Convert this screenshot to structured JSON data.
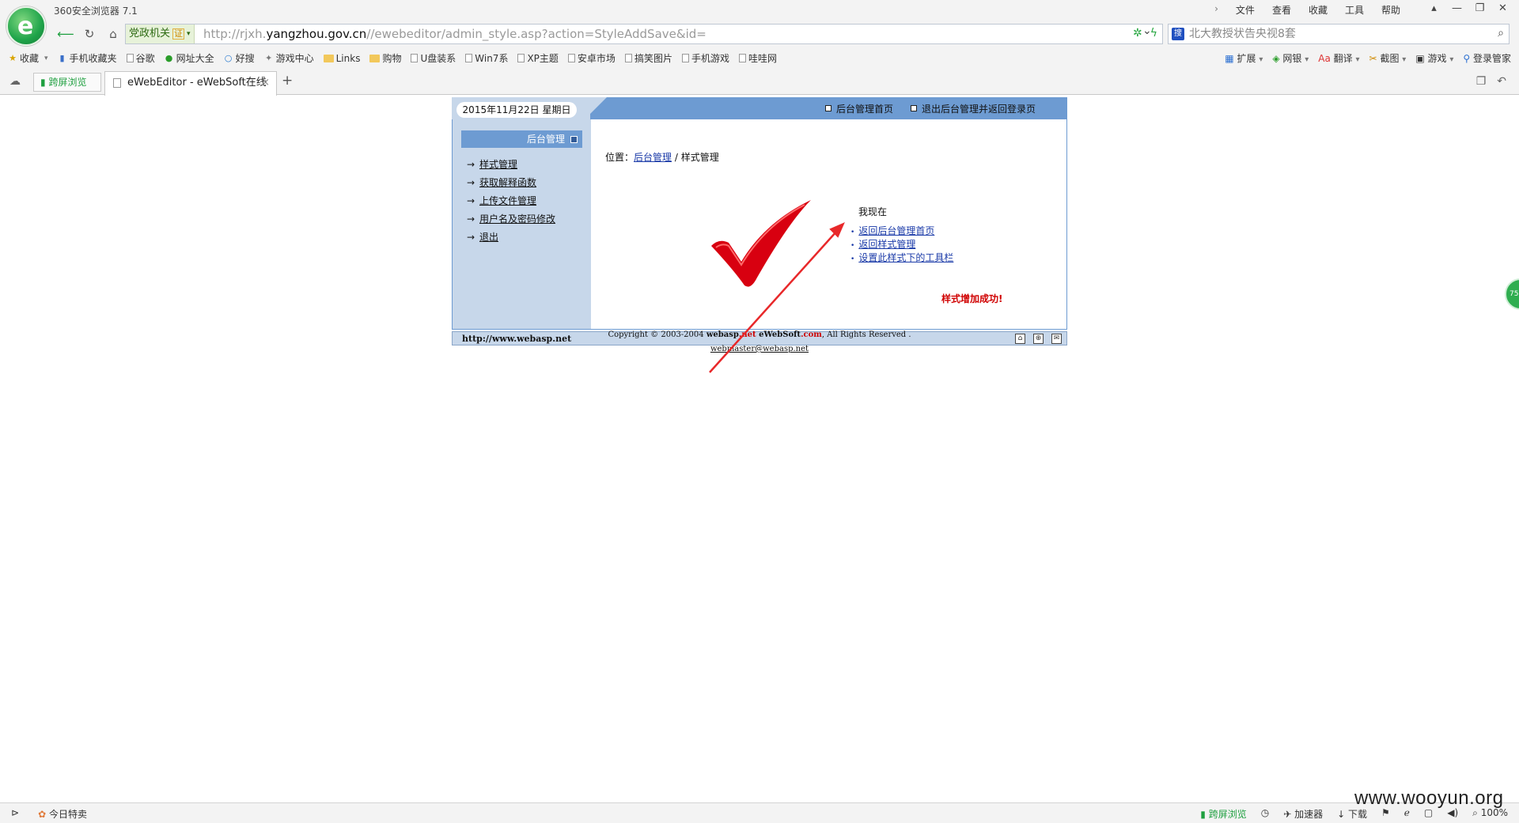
{
  "browser": {
    "app_title": "360安全浏览器 7.1",
    "menu": [
      "文件",
      "查看",
      "收藏",
      "工具",
      "帮助"
    ],
    "window_controls": [
      "衬衫",
      "最小化",
      "还原",
      "关闭"
    ],
    "zone_label": "党政机关",
    "zone_cert": "证",
    "url_prefix": "http://rjxh.",
    "url_host": "yangzhou.gov.cn",
    "url_path": "//ewebeditor/admin_style.asp?action=StyleAddSave&id=",
    "search_placeholder": "北大教授状告央视8套",
    "bookmarks": [
      "收藏",
      "手机收藏夹",
      "谷歌",
      "网址大全",
      "好搜",
      "游戏中心",
      "Links",
      "购物",
      "U盘装系",
      "Win7系",
      "XP主题",
      "安卓市场",
      "搞笑图片",
      "手机游戏",
      "哇哇网"
    ],
    "toolbar_right": [
      "扩展",
      "网银",
      "翻译",
      "截图",
      "游戏",
      "登录管家"
    ],
    "tab_split_label": "跨屏浏览",
    "tab_active_title": "eWebEditor - eWebSoft在线",
    "float_badge": "75",
    "status_left": "今日特卖",
    "status_right": [
      "跨屏浏览",
      "加速器",
      "下载",
      "100%"
    ],
    "watermark": "www.wooyun.org"
  },
  "page": {
    "date": "2015年11月22日  星期日",
    "top_links": [
      "后台管理首页",
      "退出后台管理并返回登录页"
    ],
    "side_title": "后台管理",
    "side_menu": [
      "样式管理",
      "获取解释函数",
      "上传文件管理",
      "用户名及密码修改",
      "退出"
    ],
    "breadcrumb_prefix": "位置：",
    "breadcrumb_link": "后台管理",
    "breadcrumb_sep": " / ",
    "breadcrumb_current": "样式管理",
    "success_message": "样式增加成功!",
    "now_label": "我现在",
    "next_links": [
      "返回后台管理首页",
      "返回样式管理",
      "设置此样式下的工具栏"
    ],
    "footer_site": "http://www.webasp.net",
    "copyright_pre": "Copyright © 2003-2004 ",
    "copyright_b1": "webasp",
    "copyright_r1": ".net",
    "copyright_b2": " eWebSoft",
    "copyright_r2": ".com",
    "copyright_post": ", All Rights Reserved .",
    "webmaster_email": "webmaster@webasp.net"
  },
  "colors": {
    "header_blue": "#6d9bd2",
    "side_bg": "#c7d7ea",
    "success_red": "#d00000",
    "link_blue": "#1a3aa8",
    "annotation_red": "#e8282a"
  }
}
